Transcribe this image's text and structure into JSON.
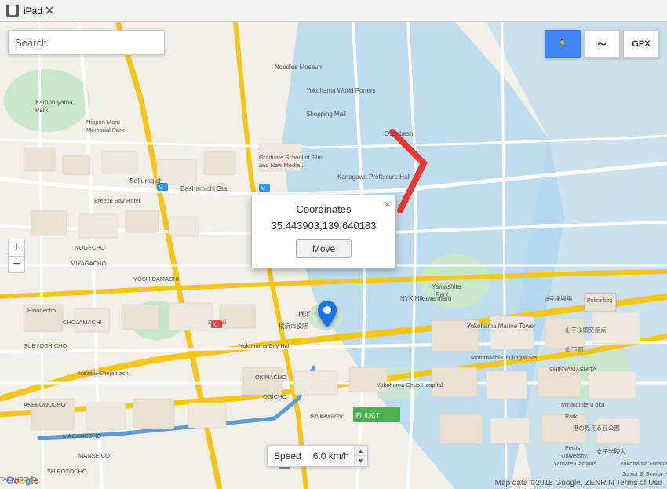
{
  "titleBar": {
    "title": "iPad",
    "iconLabel": "📱"
  },
  "search": {
    "placeholder": "Search"
  },
  "toolbar": {
    "runLabel": "🏃",
    "chartLabel": "〜",
    "gpxLabel": "GPX",
    "activeButton": "run"
  },
  "popup": {
    "title": "Coordinates",
    "coordinates": "35.443903,139.640183",
    "moveButton": "Move",
    "closeLabel": "×"
  },
  "speed": {
    "label": "Speed",
    "value": "6.0 km/h"
  },
  "attribution": "Map data ©2018 Google, ZENRIN  Terms of Use",
  "zoomIn": "+",
  "zoomOut": "−",
  "colors": {
    "road": "#ffffff",
    "majorRoad": "#f5c842",
    "water": "#a8d4f0",
    "park": "#c8e6c9",
    "land": "#f2efe9"
  }
}
